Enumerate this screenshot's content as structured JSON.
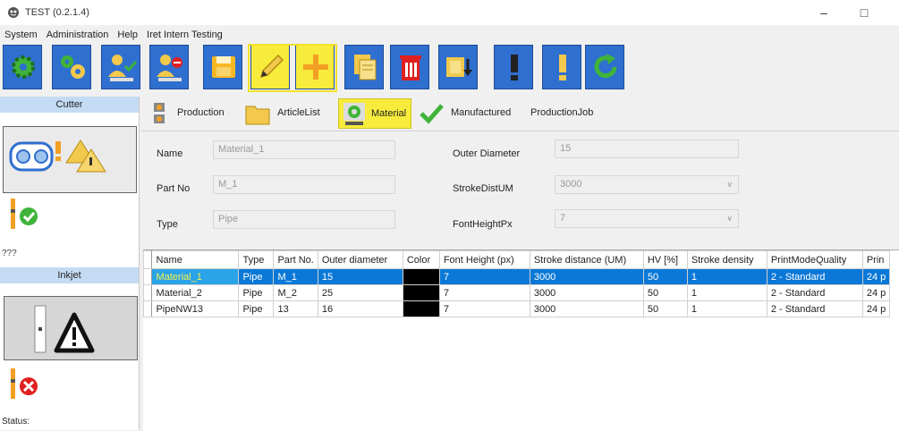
{
  "window": {
    "title": "TEST (0.2.1.4)",
    "minimize": "–",
    "maximize": "□"
  },
  "menu": [
    "System",
    "Administration",
    "Help",
    "Iret Intern Testing"
  ],
  "toolbar": {
    "buttons": [
      "gear-icon",
      "gears-icon",
      "user-check-icon",
      "user-blocked-icon",
      "save-icon",
      "edit-pencil-icon",
      "add-plus-icon",
      "copy-icon",
      "delete-trash-icon",
      "import-icon",
      "alert-icon",
      "warning-icon",
      "refresh-icon"
    ],
    "accent": "#2f6fcf",
    "highlight": "#f7ec3c"
  },
  "left": {
    "cutter_title": "Cutter",
    "unknown_text": "???",
    "inkjet_title": "Inkjet",
    "status_label": "Status:"
  },
  "tabs": [
    {
      "label": "Production",
      "active": false
    },
    {
      "label": "ArticleList",
      "active": false
    },
    {
      "label": "Material",
      "active": true
    },
    {
      "label": "Manufactured",
      "active": false
    },
    {
      "label": "ProductionJob",
      "active": false
    }
  ],
  "form": {
    "name_label": "Name",
    "name_value": "Material_1",
    "partno_label": "Part No",
    "partno_value": "M_1",
    "type_label": "Type",
    "type_value": "Pipe",
    "outer_label": "Outer Diameter",
    "outer_value": "15",
    "stroke_label": "StrokeDistUM",
    "stroke_value": "3000",
    "font_label": "FontHeightPx",
    "font_value": "7"
  },
  "grid": {
    "columns": [
      "Name",
      "Type",
      "Part No.",
      "Outer diameter",
      "Color",
      "Font Height (px)",
      "Stroke distance (UM)",
      "HV [%]",
      "Stroke density",
      "PrintModeQuality",
      "Prin"
    ],
    "rows": [
      [
        "Material_1",
        "Pipe",
        "M_1",
        "15",
        "",
        "7",
        "3000",
        "50",
        "1",
        "2 - Standard",
        "24 p"
      ],
      [
        "Material_2",
        "Pipe",
        "M_2",
        "25",
        "",
        "7",
        "3000",
        "50",
        "1",
        "2 - Standard",
        "24 p"
      ],
      [
        "PipeNW13",
        "Pipe",
        "13",
        "16",
        "",
        "7",
        "3000",
        "50",
        "1",
        "2 - Standard",
        "24 p"
      ]
    ],
    "selected_row": 0
  }
}
